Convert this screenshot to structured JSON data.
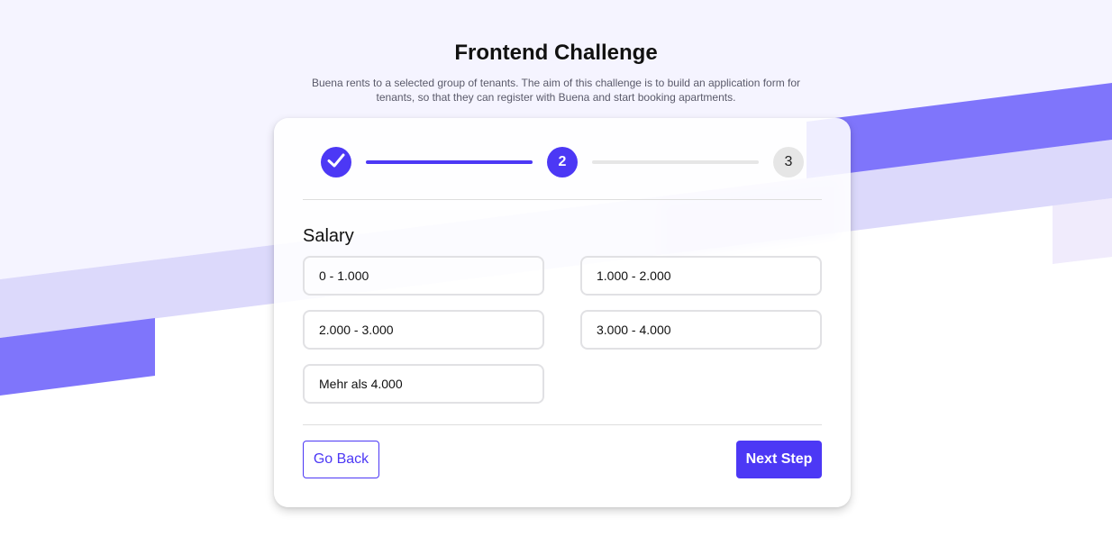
{
  "page": {
    "title": "Frontend Challenge",
    "subtitle": "Buena rents to a selected group of tenants. The aim of this challenge is to build an application form for tenants, so that they can register with Buena and start booking apartments."
  },
  "stepper": {
    "steps": [
      {
        "label": "",
        "state": "completed",
        "icon": "check-icon"
      },
      {
        "label": "2",
        "state": "active"
      },
      {
        "label": "3",
        "state": "upcoming"
      }
    ],
    "progress_segments": [
      {
        "state": "complete"
      },
      {
        "state": "incomplete"
      }
    ]
  },
  "form": {
    "section_title": "Salary",
    "options": [
      {
        "label": "0 - 1.000"
      },
      {
        "label": "1.000 - 2.000"
      },
      {
        "label": "2.000 - 3.000"
      },
      {
        "label": "3.000 - 4.000"
      },
      {
        "label": "Mehr als 4.000"
      }
    ]
  },
  "actions": {
    "back_label": "Go Back",
    "next_label": "Next Step"
  },
  "colors": {
    "accent": "#4c38f5",
    "background_band_dark": "#7f75fb",
    "background_band_light": "#dcd9fb",
    "background_top": "#f5f4ff",
    "inactive": "#e6e6e6"
  }
}
